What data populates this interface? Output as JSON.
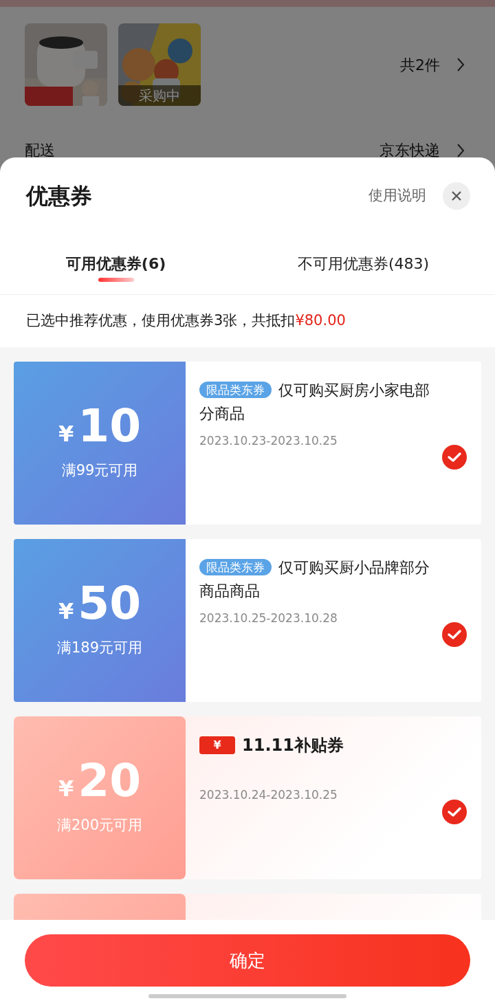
{
  "background_page": {
    "products": [
      {
        "kind": "picture"
      },
      {
        "kind": "picture",
        "overlay": "采购中"
      }
    ],
    "count": "共2件",
    "delivery_label": "配送",
    "delivery_value": "京东快递"
  },
  "sheet": {
    "title": "优惠券",
    "help": "使用说明",
    "tabs": [
      {
        "label": "可用优惠券(6)",
        "selected": true
      },
      {
        "label": "不可用优惠券(483)",
        "selected": false
      }
    ],
    "summary": "已选中推荐优惠，使用优惠券3张，共抵扣",
    "summary_amount": "¥80.00",
    "coupons": [
      {
        "kind": "jd",
        "currency": "¥",
        "amount": "10",
        "condition": "满99元可用",
        "tag": "限品类东券",
        "description": "仅可购买厨房小家电部分商品",
        "dates": "2023.10.23-2023.10.25",
        "selected": true
      },
      {
        "kind": "jd",
        "currency": "¥",
        "amount": "50",
        "condition": "满189元可用",
        "tag": "限品类东券",
        "description": "仅可购买厨小品牌部分商品商品",
        "dates": "2023.10.25-2023.10.28",
        "selected": true
      },
      {
        "kind": "subsidy",
        "currency": "¥",
        "amount": "20",
        "condition": "满200元可用",
        "badge": "¥",
        "title": "11.11补贴券",
        "dates": "2023.10.24-2023.10.25",
        "selected": true
      }
    ],
    "confirm": "确定"
  }
}
